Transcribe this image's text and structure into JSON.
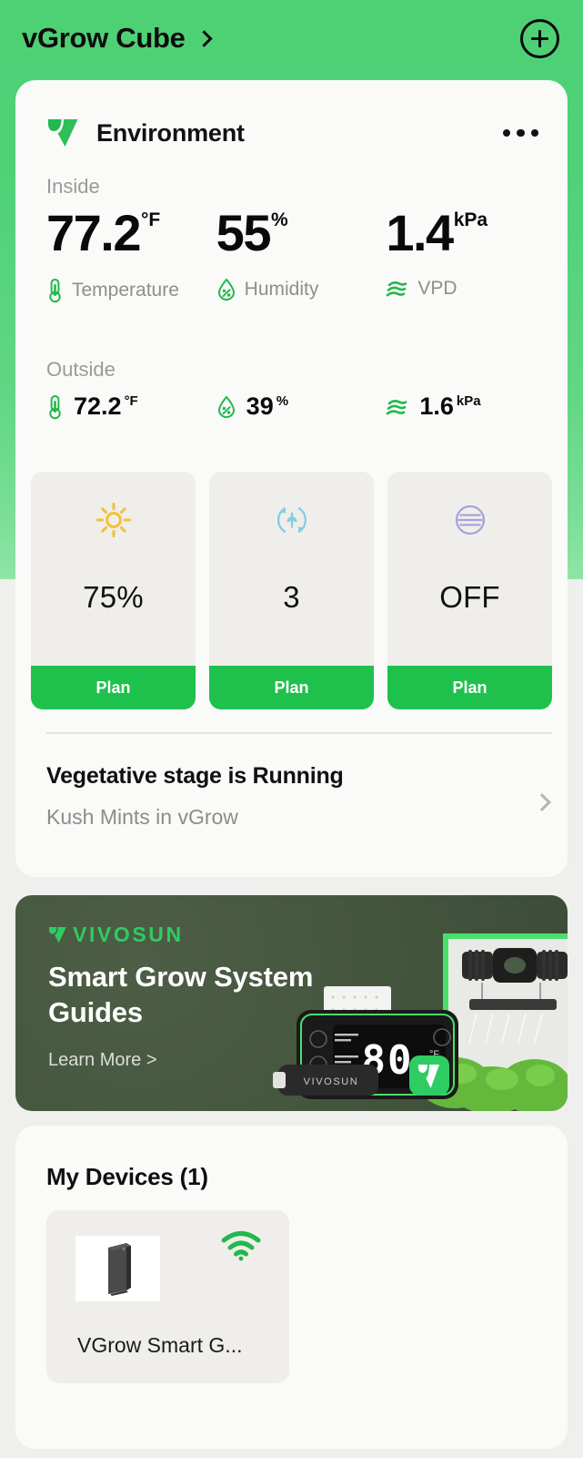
{
  "header": {
    "title": "vGrow Cube",
    "chevron_icon": "chevron-right-icon",
    "add_button_icon": "plus-circle-icon"
  },
  "environment": {
    "logo_icon": "vivosun-leaf-logo-icon",
    "title": "Environment",
    "more_icon": "more-options-icon",
    "inside": {
      "label": "Inside",
      "metrics": [
        {
          "value": "77.2",
          "unit": "°F",
          "name": "Temperature",
          "icon": "thermometer-icon",
          "color": "#22B84D"
        },
        {
          "value": "55",
          "unit": "%",
          "name": "Humidity",
          "icon": "humidity-droplet-icon",
          "color": "#22B84D"
        },
        {
          "value": "1.4",
          "unit": "kPa",
          "name": "VPD",
          "icon": "vpd-waves-icon",
          "color": "#22B84D"
        }
      ]
    },
    "outside": {
      "label": "Outside",
      "metrics": [
        {
          "value": "72.2",
          "unit": "°F",
          "icon": "thermometer-icon"
        },
        {
          "value": "39",
          "unit": "%",
          "icon": "humidity-droplet-icon"
        },
        {
          "value": "1.6",
          "unit": "kPa",
          "icon": "vpd-waves-icon"
        }
      ]
    },
    "controls": [
      {
        "icon": "sun-icon",
        "icon_color": "#F2C23C",
        "value": "75%",
        "button_label": "Plan"
      },
      {
        "icon": "air-circulation-leaf-icon",
        "icon_color": "#82CDE6",
        "value": "3",
        "button_label": "Plan"
      },
      {
        "icon": "humidifier-mist-icon",
        "icon_color": "#A9A4DC",
        "value": "OFF",
        "button_label": "Plan"
      }
    ],
    "stage": {
      "title": "Vegetative stage is Running",
      "subtitle": "Kush Mints in vGrow",
      "chevron_icon": "chevron-right-icon"
    }
  },
  "banner": {
    "brand": "VIVOSUN",
    "brand_icon": "vivosun-leaf-logo-icon",
    "headline": "Smart Grow System Guides",
    "cta": "Learn More >",
    "display_value": "80",
    "background_color": "#44553E"
  },
  "devices": {
    "title": "My Devices (1)",
    "items": [
      {
        "name": "VGrow Smart G...",
        "thumbnail_icon": "grow-cabinet-icon",
        "status_icon": "wifi-icon",
        "status_color": "#22B84D"
      }
    ]
  },
  "theme": {
    "header_green": "#4ED175",
    "accent_green": "#1FC14D",
    "page_background": "#EFEFED",
    "card_background": "#FAFAF8",
    "tile_background": "#EFEEEA"
  }
}
